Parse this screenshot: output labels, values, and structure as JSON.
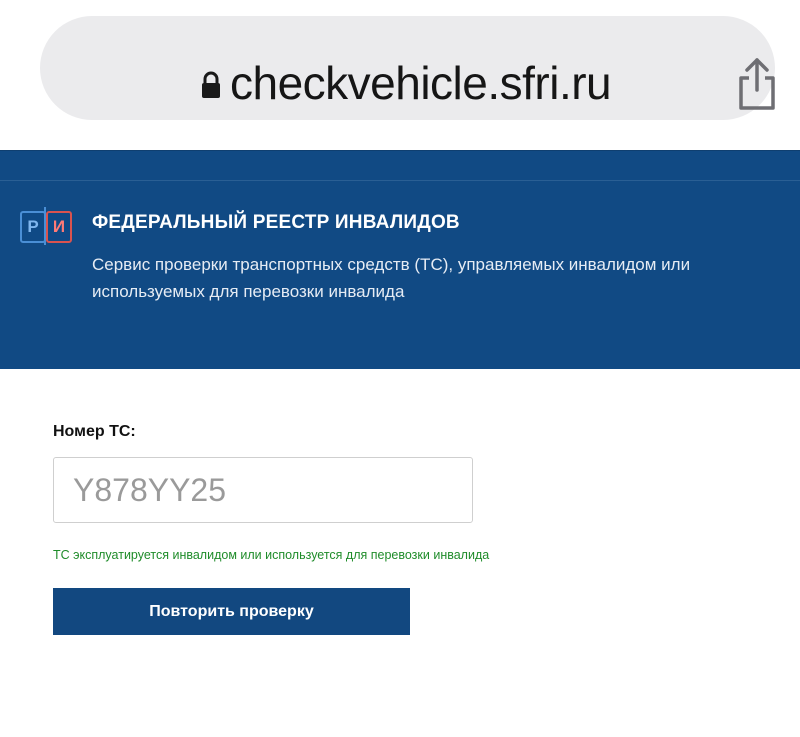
{
  "browser": {
    "url": "checkvehicle.sfri.ru",
    "lock_icon": "lock-icon",
    "share_icon": "share-icon"
  },
  "header": {
    "logo": {
      "left_letter": "Р",
      "right_letter": "И"
    },
    "title": "ФЕДЕРАЛЬНЫЙ РЕЕСТР ИНВАЛИДОВ",
    "subtitle": "Сервис проверки транспортных средств (ТС), управляемых инвалидом или используемых для перевозки инвалида"
  },
  "form": {
    "label": "Номер ТС:",
    "plate_value": "Y878YY25",
    "result_message": "ТС эксплуатируется инвалидом или используется для перевозки инвалида",
    "retry_label": "Повторить проверку"
  },
  "colors": {
    "banner": "#114a84",
    "button": "#124880",
    "success_text": "#1f8c2a"
  }
}
